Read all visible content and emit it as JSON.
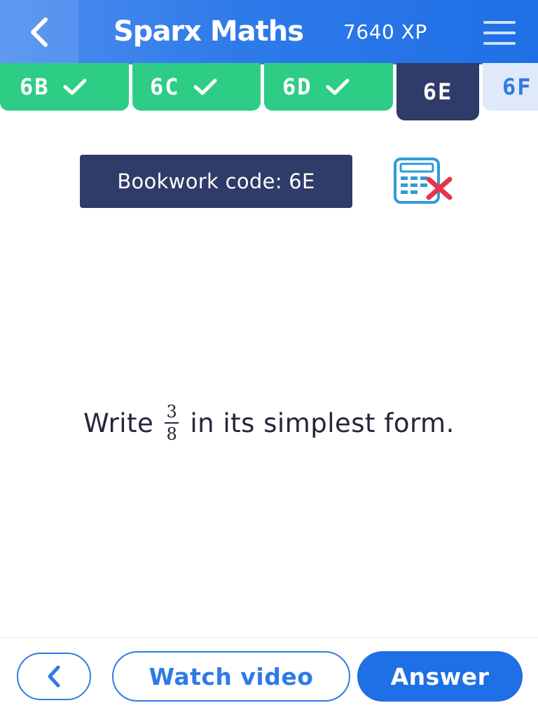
{
  "header": {
    "title": "Sparx Maths",
    "xp": "7640 XP",
    "back_icon": "chevron-left-icon",
    "menu_icon": "hamburger-menu-icon"
  },
  "tabs": [
    {
      "label": "6B",
      "state": "completed"
    },
    {
      "label": "6C",
      "state": "completed"
    },
    {
      "label": "6D",
      "state": "completed"
    },
    {
      "label": "6E",
      "state": "current"
    },
    {
      "label": "6F",
      "state": "upcoming"
    }
  ],
  "bookwork": {
    "label": "Bookwork code: 6E",
    "calculator_icon": "calculator-not-allowed-icon"
  },
  "question": {
    "prefix": "Write",
    "numerator": "3",
    "denominator": "8",
    "suffix": "in its simplest form."
  },
  "footer": {
    "back_icon": "chevron-left-icon",
    "watch_video": "Watch video",
    "answer": "Answer"
  },
  "colors": {
    "header_blue": "#2e7ae9",
    "completed_green": "#2ecd86",
    "active_navy": "#2f3b68",
    "button_blue": "#1f6fe6",
    "danger_red": "#e5354d"
  }
}
